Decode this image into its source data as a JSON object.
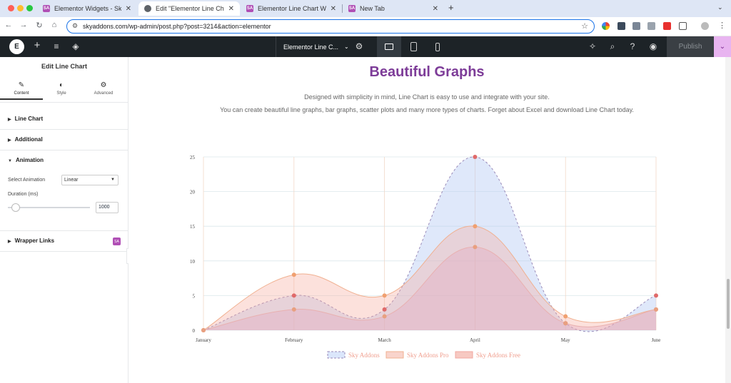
{
  "browser": {
    "tabs": [
      {
        "title": "Elementor Widgets - Sky Addons",
        "favicon": "sky-addons-icon"
      },
      {
        "title": "Edit \"Elementor Line Chart Widget\"",
        "favicon": "globe-icon"
      },
      {
        "title": "Elementor Line Chart Widget",
        "favicon": "sky-addons-icon"
      },
      {
        "title": "New Tab",
        "favicon": "sky-addons-icon"
      }
    ],
    "url": "skyaddons.com/wp-admin/post.php?post=3214&action=elementor"
  },
  "editor": {
    "document_title": "Elementor Line C...",
    "publish_label": "Publish"
  },
  "panel": {
    "title": "Edit Line Chart",
    "tabs": [
      "Content",
      "Style",
      "Advanced"
    ],
    "sections": {
      "line_chart": "Line Chart",
      "additional": "Additional",
      "animation": "Animation",
      "wrapper_links": "Wrapper Links"
    },
    "select_animation_label": "Select Animation",
    "select_animation_value": "Linear",
    "duration_label": "Duration (ms)",
    "duration_value": "1000"
  },
  "page": {
    "heading": "Beautiful Graphs",
    "desc1": "Designed with simplicity in mind, Line Chart is easy to use and integrate with your site.",
    "desc2": "You can create beautiful line graphs, bar graphs, scatter plots and many more types of charts. Forget about Excel and download Line Chart today."
  },
  "colors": {
    "heading": "#7d3c98",
    "series_blue_fill": "#dbe6fb",
    "series_orange_fill": "#f7c9c2",
    "point_red": "#e06a6a",
    "point_orange": "#f0a070"
  },
  "chart_data": {
    "type": "line",
    "x": [
      "January",
      "February",
      "March",
      "April",
      "May",
      "June"
    ],
    "ylim": [
      0,
      25
    ],
    "yticks": [
      0,
      5,
      10,
      15,
      20,
      25
    ],
    "grid": true,
    "legend_position": "bottom",
    "series": [
      {
        "name": "Sky Addons",
        "values": [
          0,
          5,
          3,
          25,
          1,
          5
        ],
        "style": "dashed"
      },
      {
        "name": "Sky Addons Pro",
        "values": [
          0,
          8,
          5,
          15,
          2,
          3
        ]
      },
      {
        "name": "Sky Addons Free",
        "values": [
          0,
          3,
          2,
          12,
          1,
          3
        ]
      }
    ]
  }
}
